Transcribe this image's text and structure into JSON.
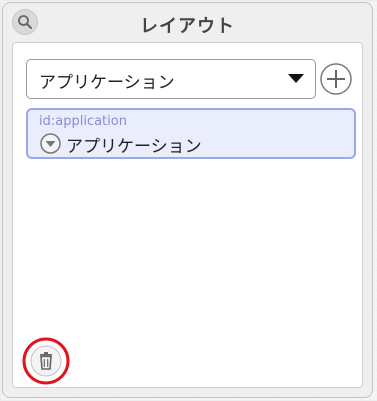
{
  "header": {
    "title": "レイアウト",
    "search_icon": "search-icon"
  },
  "toolbar": {
    "select_value": "アプリケーション",
    "dropdown_icon": "chevron-down-icon",
    "add_icon": "plus-circle-icon"
  },
  "layout_items": [
    {
      "id_text": "id:application",
      "label": "アプリケーション",
      "toggle_icon": "collapse-toggle-icon"
    }
  ],
  "footer": {
    "trash_icon": "trash-icon"
  },
  "colors": {
    "selection_border": "#9ba8ea",
    "selection_fill": "#eaeefc",
    "id_text": "#8a8ad8",
    "highlight_ring": "#e0141e"
  }
}
